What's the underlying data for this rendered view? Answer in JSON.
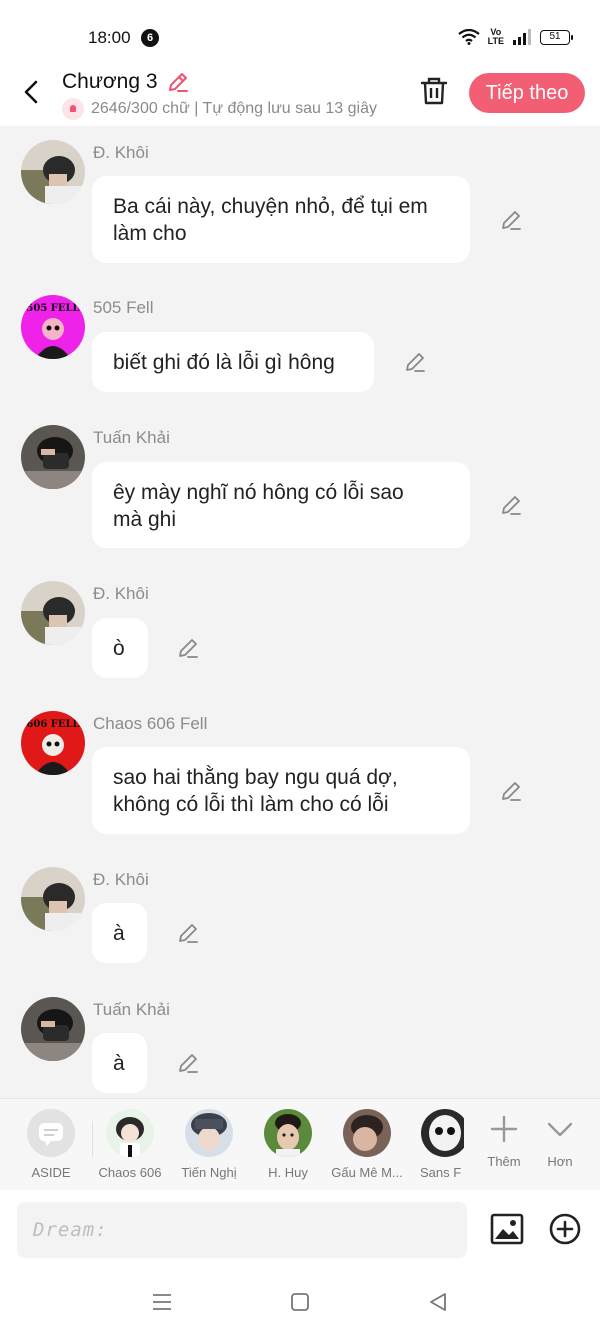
{
  "status_bar": {
    "time": "18:00",
    "notification_count": "6",
    "network_label_top": "Vo",
    "network_label_bottom": "LTE",
    "battery": "51"
  },
  "header": {
    "title": "Chương 3",
    "subtitle": "2646/300 chữ | Tự động lưu sau 13 giây",
    "next_button": "Tiếp theo"
  },
  "messages": [
    {
      "sender": "Đ. Khôi",
      "lines": [
        "Ba cái này, chuyện nhỏ, để tụi em",
        "làm cho"
      ]
    },
    {
      "sender": "505 Fell",
      "lines": [
        "biết ghi đó là lỗi gì hông"
      ],
      "avatar_text": "505 FELL"
    },
    {
      "sender": "Tuấn Khải",
      "lines": [
        "êy mày nghĩ nó hông có lỗi sao",
        "mà ghi"
      ]
    },
    {
      "sender": "Đ. Khôi",
      "lines": [
        "ò"
      ]
    },
    {
      "sender": "Chaos 606 Fell",
      "lines": [
        "sao hai thằng bay ngu quá dợ,",
        "không có lỗi thì làm cho có lỗi"
      ],
      "avatar_text": "606 FELL"
    },
    {
      "sender": "Đ. Khôi",
      "lines": [
        "à"
      ]
    },
    {
      "sender": "Tuấn Khải",
      "lines": [
        "à"
      ]
    }
  ],
  "characters": [
    {
      "label": "ASIDE"
    },
    {
      "label": "Chaos 606"
    },
    {
      "label": "Tiến Nghị"
    },
    {
      "label": "H. Huy"
    },
    {
      "label": "Gấu Mê M..."
    },
    {
      "label": "Sans F"
    }
  ],
  "strip_actions": {
    "more": "Thêm",
    "collapse": "Hơn"
  },
  "input": {
    "placeholder": "Dream:"
  },
  "colors": {
    "accent": "#f25f74",
    "background": "#f3f3f3",
    "bubble": "#ffffff"
  }
}
